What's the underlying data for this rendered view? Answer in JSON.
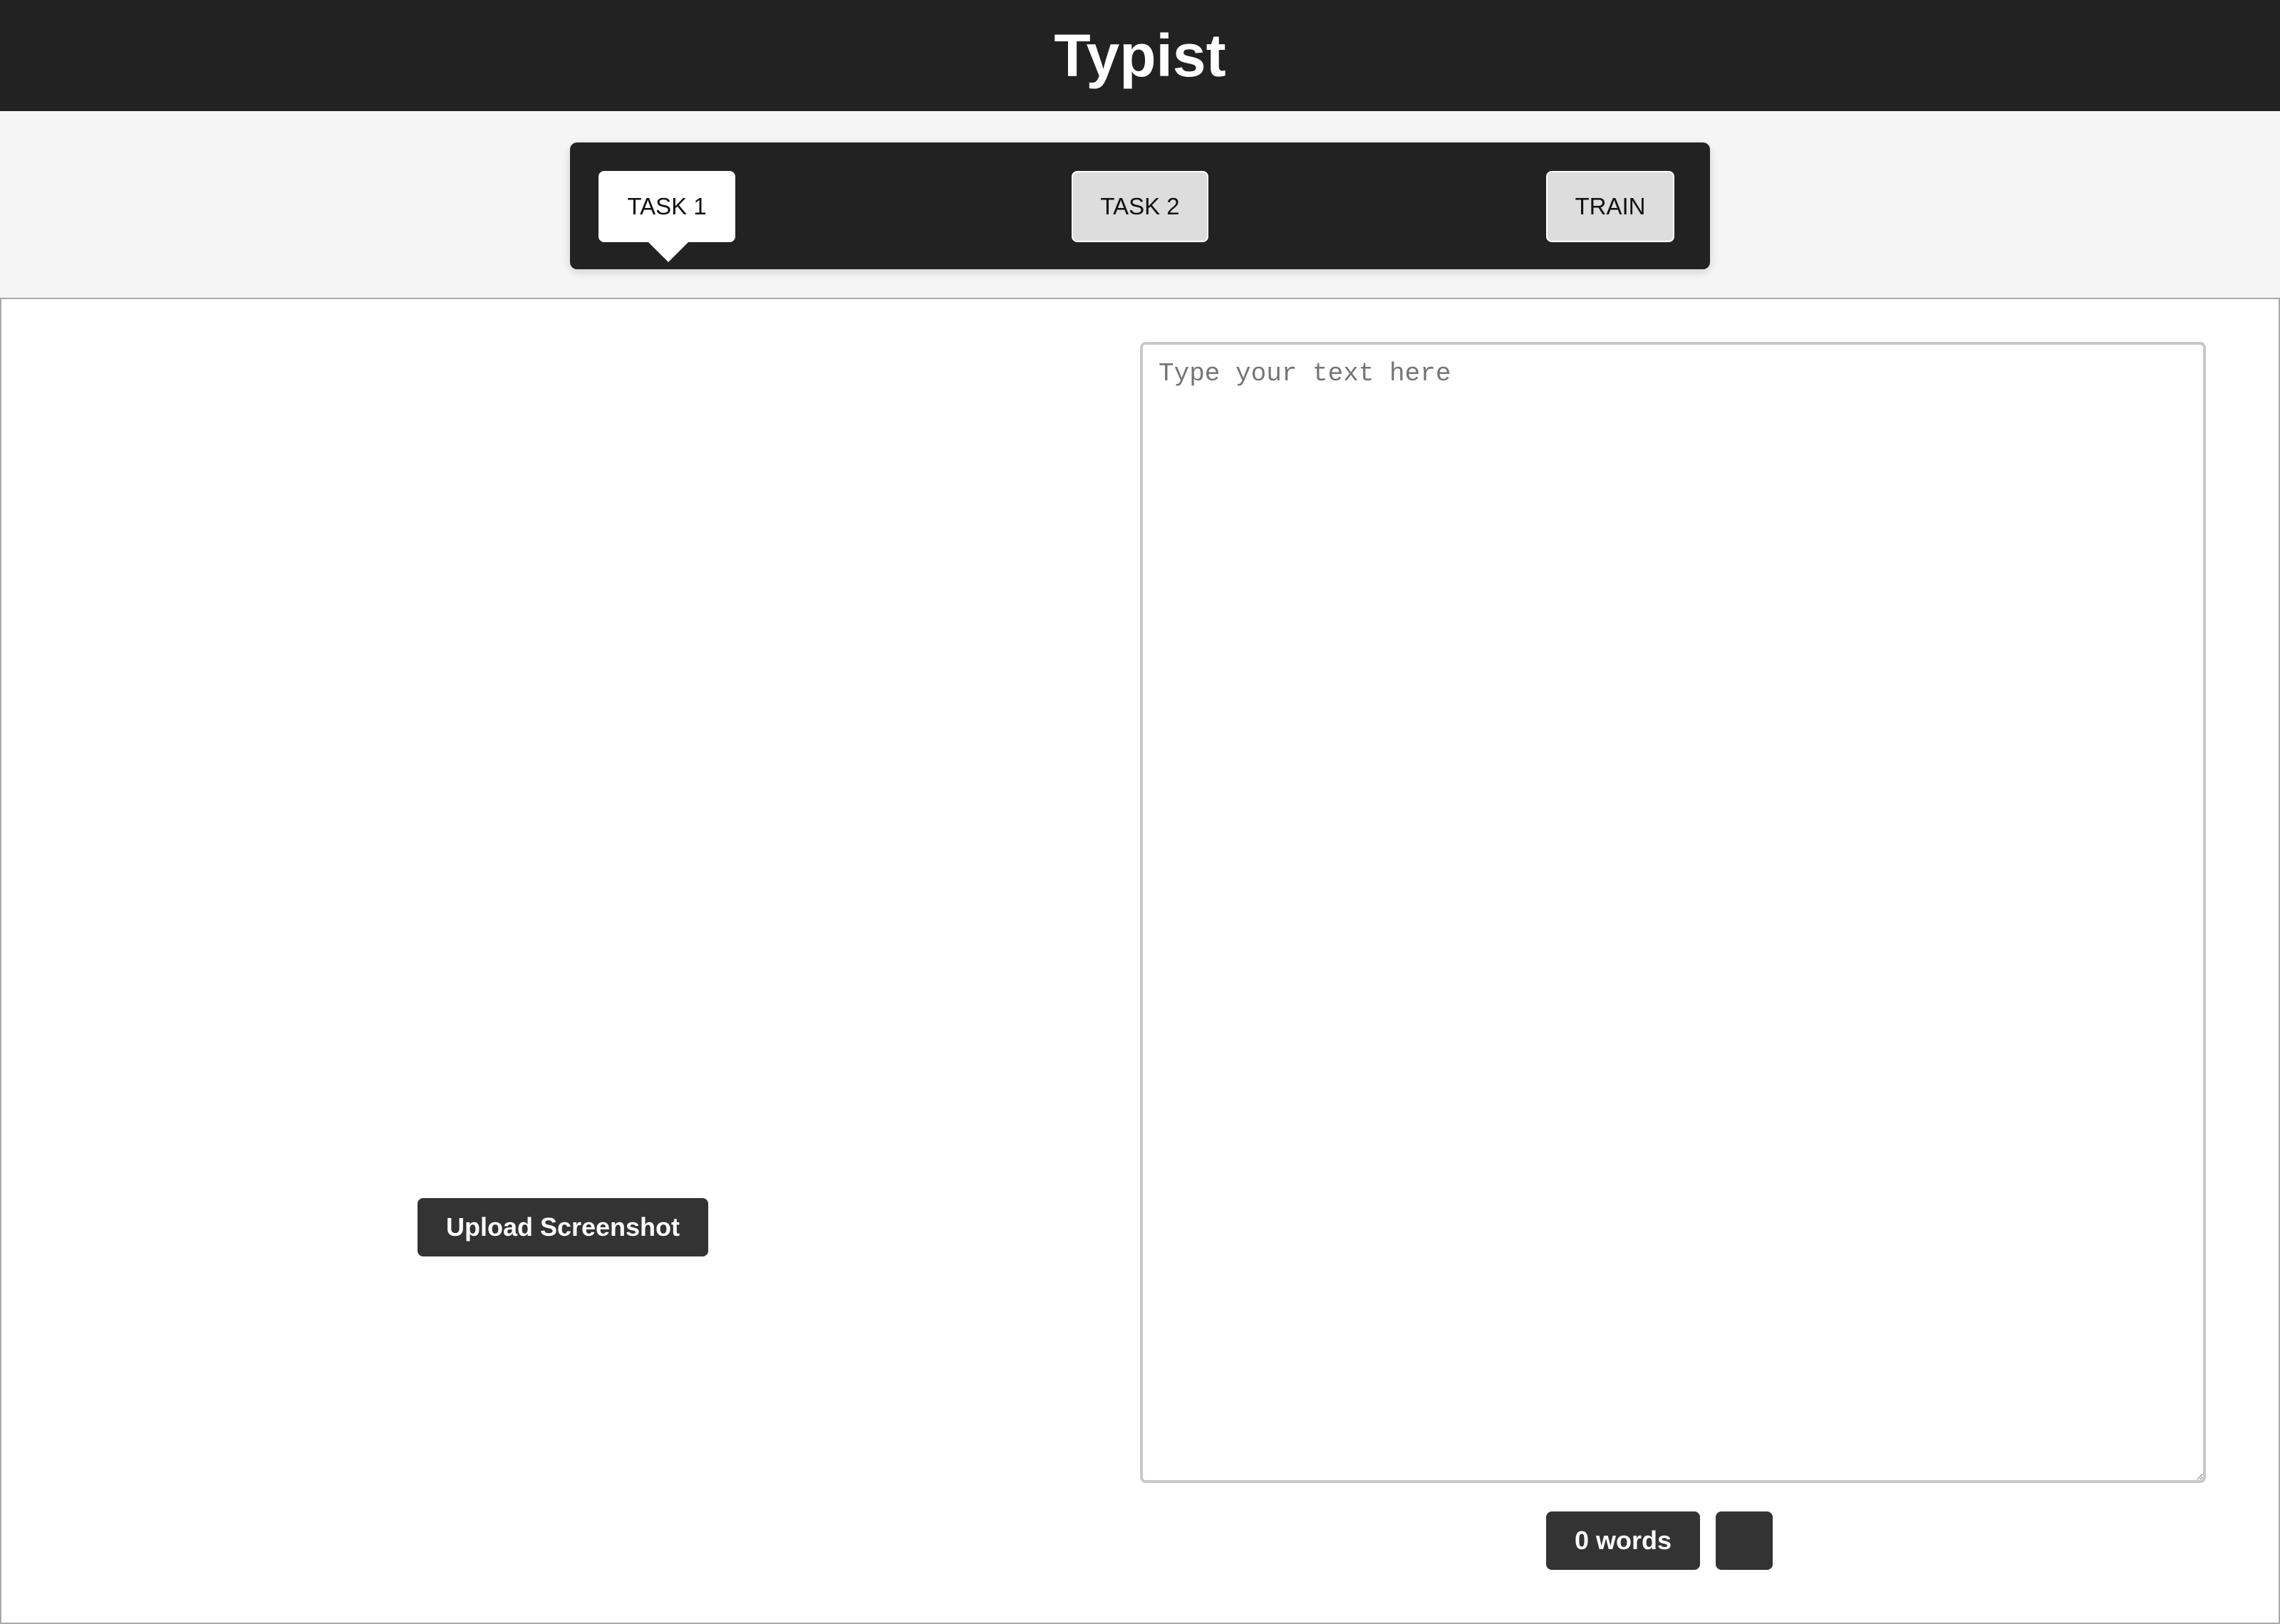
{
  "app": {
    "title": "Typist"
  },
  "tabs": [
    {
      "label": "TASK 1",
      "active": true
    },
    {
      "label": "TASK 2",
      "active": false
    },
    {
      "label": "TRAIN",
      "active": false
    }
  ],
  "left_panel": {
    "upload_label": "Upload Screenshot"
  },
  "editor": {
    "placeholder": "Type your text here",
    "value": "",
    "word_count_label": "0 words",
    "extra_button_label": ""
  },
  "colors": {
    "header_bg": "#222222",
    "page_bg": "#f5f5f5",
    "button_dark": "#333333",
    "tab_inactive": "#dddddd",
    "tab_active": "#ffffff"
  }
}
